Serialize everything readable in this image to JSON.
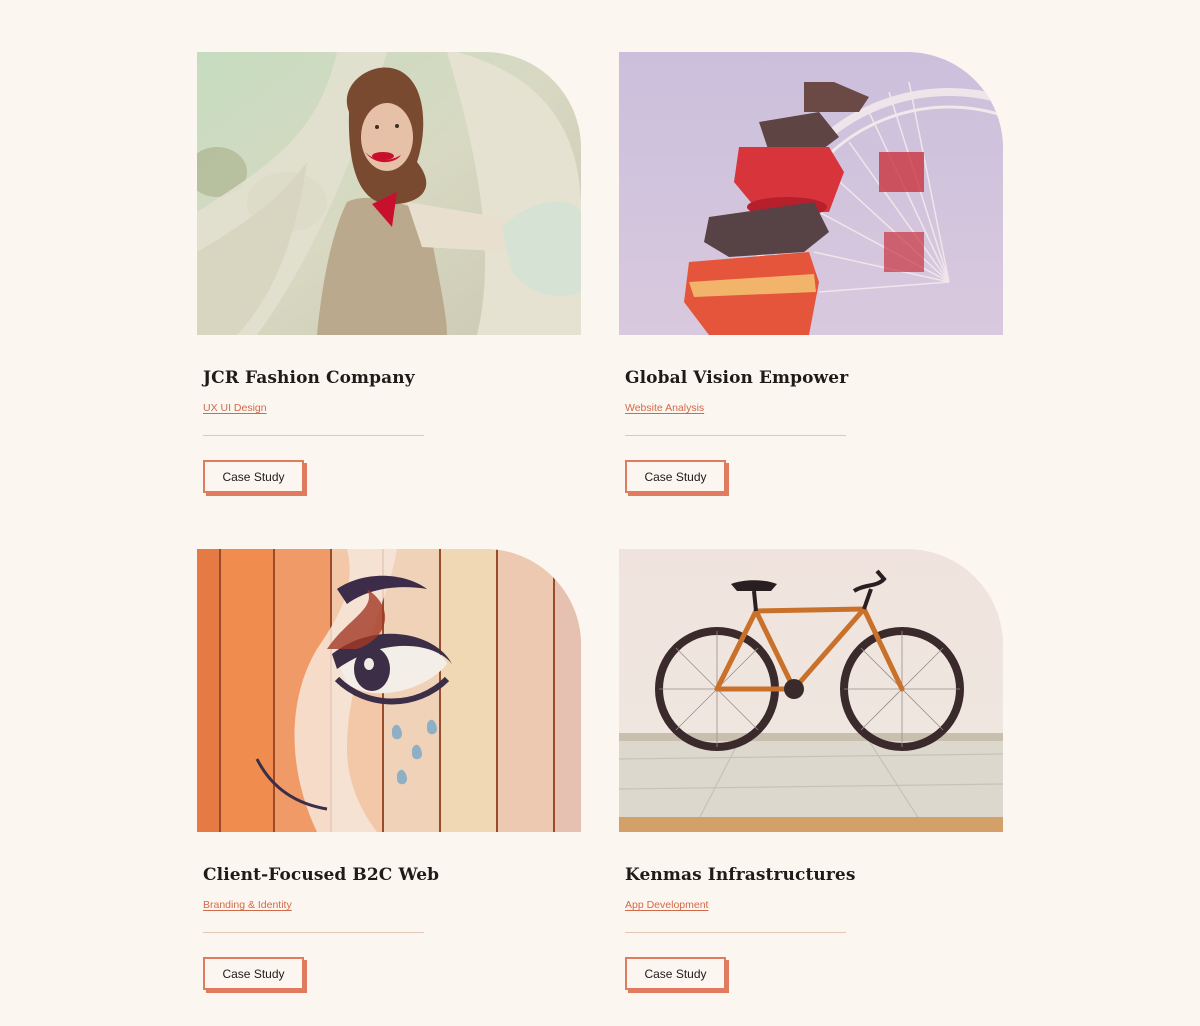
{
  "projects": [
    {
      "title": "JCR Fashion Company",
      "category": "UX UI Design",
      "button_label": "Case Study",
      "image_subject": "woman in cream dress with red lipstick and white drape"
    },
    {
      "title": "Global Vision Empower",
      "category": "Website Analysis",
      "button_label": "Case Study",
      "image_subject": "ferris wheel with red and orange gondolas against purple sky"
    },
    {
      "title": "Client-Focused B2C Web",
      "category": "Branding & Identity",
      "button_label": "Case Study",
      "image_subject": "painted eye mural on wooden fence"
    },
    {
      "title": "Kenmas Infrastructures",
      "category": "App Development",
      "button_label": "Case Study",
      "image_subject": "copper fixed-gear bicycle against white wall"
    }
  ],
  "colors": {
    "background": "#fbf6ef",
    "accent": "#e07b5f",
    "link": "#d26a4a",
    "heading": "#1f1b18"
  }
}
